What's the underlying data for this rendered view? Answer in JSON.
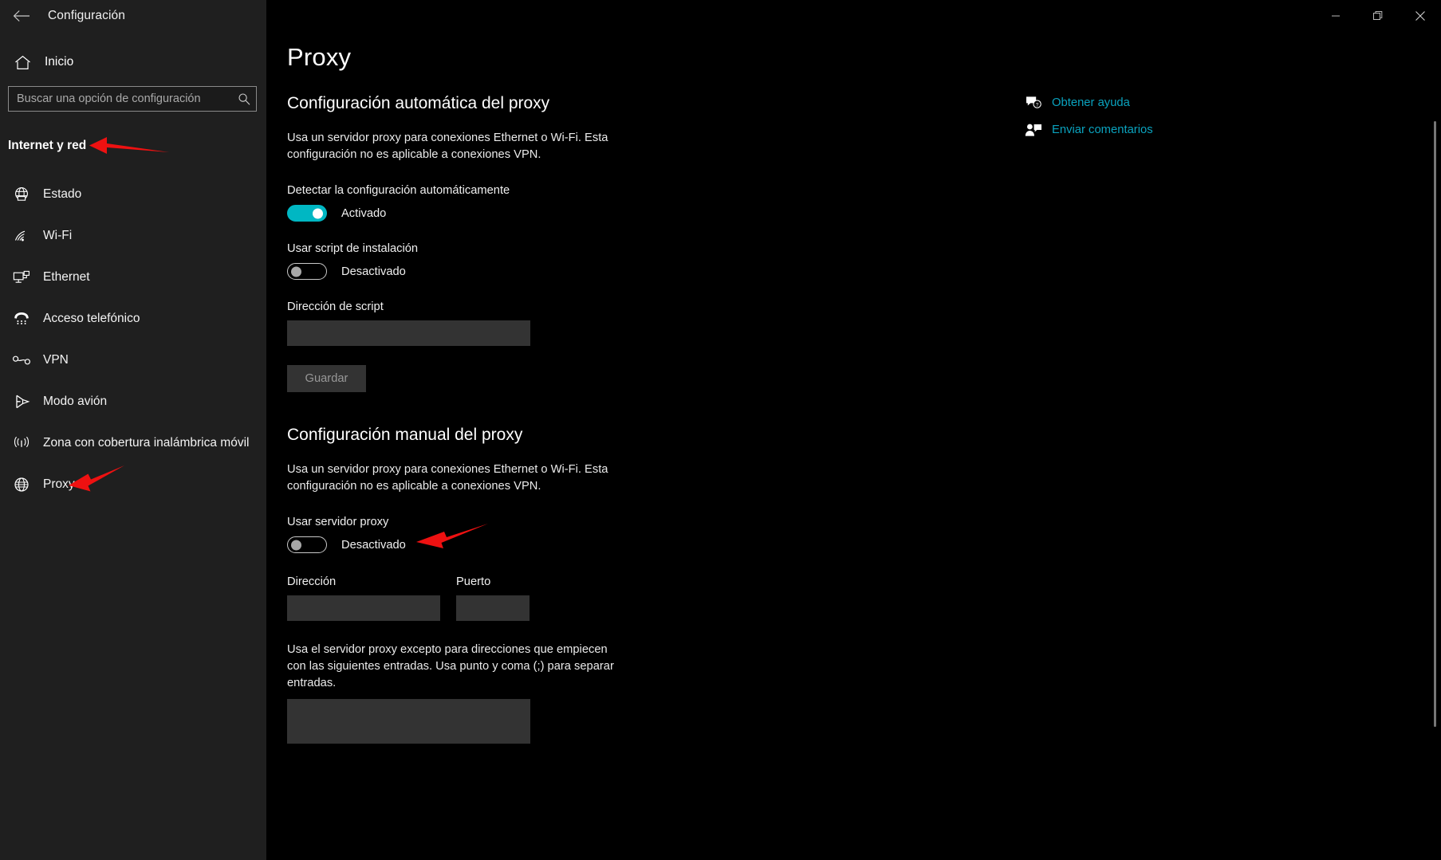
{
  "window": {
    "app_title": "Configuración",
    "back_icon": "back-arrow-icon",
    "minimize_label": "Minimizar",
    "maximize_label": "Restaurar",
    "close_label": "Cerrar"
  },
  "sidebar": {
    "home_label": "Inicio",
    "home_icon": "home-icon",
    "search": {
      "placeholder": "Buscar una opción de configuración",
      "value": "",
      "icon": "search-icon"
    },
    "group_title": "Internet y red",
    "items": [
      {
        "label": "Estado",
        "icon": "globe-status-icon"
      },
      {
        "label": "Wi-Fi",
        "icon": "wifi-icon"
      },
      {
        "label": "Ethernet",
        "icon": "ethernet-icon"
      },
      {
        "label": "Acceso telefónico",
        "icon": "dialup-phone-icon"
      },
      {
        "label": "VPN",
        "icon": "vpn-icon"
      },
      {
        "label": "Modo avión",
        "icon": "airplane-icon"
      },
      {
        "label": "Zona con cobertura inalámbrica móvil",
        "icon": "hotspot-icon"
      },
      {
        "label": "Proxy",
        "icon": "globe-proxy-icon"
      }
    ]
  },
  "main": {
    "page_title": "Proxy",
    "auto_section": {
      "heading": "Configuración automática del proxy",
      "description": "Usa un servidor proxy para conexiones Ethernet o Wi-Fi. Esta configuración no es aplicable a conexiones VPN.",
      "detect_label": "Detectar la configuración automáticamente",
      "detect_state": "Activado",
      "detect_on": true,
      "script_toggle_label": "Usar script de instalación",
      "script_state": "Desactivado",
      "script_on": false,
      "script_address_label": "Dirección de script",
      "script_address_value": "",
      "save_label": "Guardar"
    },
    "manual_section": {
      "heading": "Configuración manual del proxy",
      "description": "Usa un servidor proxy para conexiones Ethernet o Wi-Fi. Esta configuración no es aplicable a conexiones VPN.",
      "use_proxy_label": "Usar servidor proxy",
      "use_proxy_state": "Desactivado",
      "use_proxy_on": false,
      "address_label": "Dirección",
      "address_value": "",
      "port_label": "Puerto",
      "port_value": "",
      "exceptions_description": "Usa el servidor proxy excepto para direcciones que empiecen con las siguientes entradas. Usa punto y coma (;) para separar entradas.",
      "exceptions_value": ""
    }
  },
  "help": {
    "items": [
      {
        "label": "Obtener ayuda",
        "icon": "help-bubble-icon"
      },
      {
        "label": "Enviar comentarios",
        "icon": "feedback-person-icon"
      }
    ]
  },
  "colors": {
    "accent_teal": "#00b7c3",
    "link_teal": "#0aa3bf",
    "annotation_red": "#ee1111",
    "sidebar_bg": "#1f1f1f",
    "content_bg": "#000000",
    "input_bg": "#333333"
  }
}
